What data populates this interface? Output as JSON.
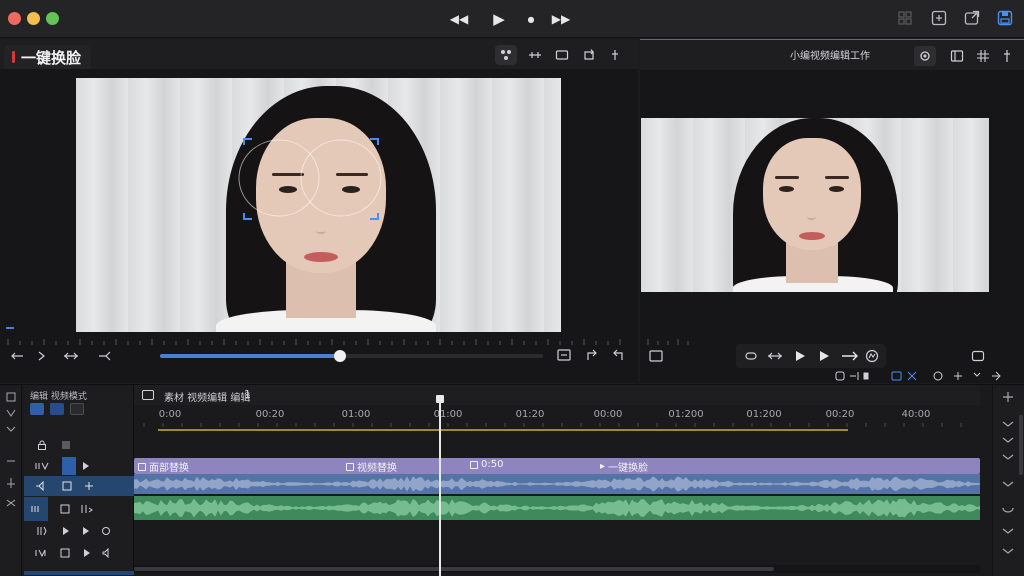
{
  "transport": {
    "rewind": "◀◀",
    "play": "▶",
    "stop": "●",
    "forward": "▶▶"
  },
  "left_panel": {
    "title": "一键换脸"
  },
  "right_panel": {
    "title": "小编视频编辑工作"
  },
  "timeline": {
    "header_title": "编辑 视频模式",
    "sequence_label": "素材 视频编辑 编辑",
    "sequence_number": "1",
    "ruler": [
      "0:00",
      "00:20",
      "01:00",
      "01:00",
      "01:20",
      "00:00",
      "01:200",
      "01:200",
      "00:20",
      "40:00"
    ],
    "clips": [
      {
        "label": "面部替换"
      },
      {
        "label": "视频替换"
      },
      {
        "label": "0:50"
      },
      {
        "label": "一键换脸"
      }
    ]
  },
  "colors": {
    "accent": "#4a7fd8",
    "video_track": "#8e84c0",
    "audio1": "#5574a6",
    "audio2": "#3e8a5c",
    "playhead": "#e8e8e8",
    "close": "#ed6a5e",
    "minimize": "#f4be4f",
    "zoom": "#61c454"
  }
}
